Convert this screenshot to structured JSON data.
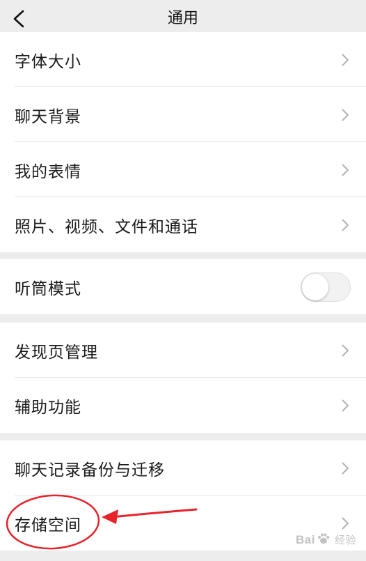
{
  "nav": {
    "title": "通用",
    "back_icon": "chevron-left-icon"
  },
  "groups": [
    {
      "items": [
        {
          "label": "字体大小",
          "accessory": "chevron"
        },
        {
          "label": "聊天背景",
          "accessory": "chevron"
        },
        {
          "label": "我的表情",
          "accessory": "chevron"
        },
        {
          "label": "照片、视频、文件和通话",
          "accessory": "chevron"
        }
      ]
    },
    {
      "items": [
        {
          "label": "听筒模式",
          "accessory": "toggle",
          "toggle_on": false
        }
      ]
    },
    {
      "items": [
        {
          "label": "发现页管理",
          "accessory": "chevron"
        },
        {
          "label": "辅助功能",
          "accessory": "chevron"
        }
      ]
    },
    {
      "items": [
        {
          "label": "聊天记录备份与迁移",
          "accessory": "chevron"
        },
        {
          "label": "存储空间",
          "accessory": "chevron",
          "highlighted": true
        }
      ]
    }
  ],
  "annotation": {
    "shape": "red ellipse with arrow",
    "color": "#e8232b"
  },
  "watermark": {
    "text_left": "Bai",
    "text_right": "经验",
    "icon": "baidu-paw-icon",
    "color": "#c3c3c3"
  },
  "colors": {
    "background": "#ededed",
    "row": "#ffffff",
    "text": "#1a1a1a",
    "chevron": "#b2b2b2"
  }
}
